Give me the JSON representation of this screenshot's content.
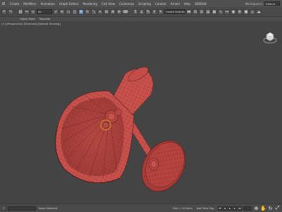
{
  "menubar": {
    "items": [
      "Create",
      "Modifiers",
      "Animation",
      "Graph Editors",
      "Rendering",
      "Civil View",
      "Customize",
      "Scripting",
      "Content",
      "Arnold",
      "Help",
      "3DSRGB"
    ],
    "workspaces_label": "Workspaces:",
    "workspace_value": "Default"
  },
  "toolbar": {
    "selection_filter": "All",
    "named_selection": "Create Selection Set"
  },
  "ribbon": {
    "tabs": [
      "Object Paint",
      "Populate"
    ]
  },
  "viewport": {
    "label": "[+] [Perspective] [Standard] [Default Shading]",
    "model_color": "#c9524c",
    "wire_color": "#5a1a18"
  },
  "statusbar": {
    "grid": "Grid = 10.0mm",
    "add_time_tag": "Add Time Tag",
    "selected": "None Selected"
  }
}
